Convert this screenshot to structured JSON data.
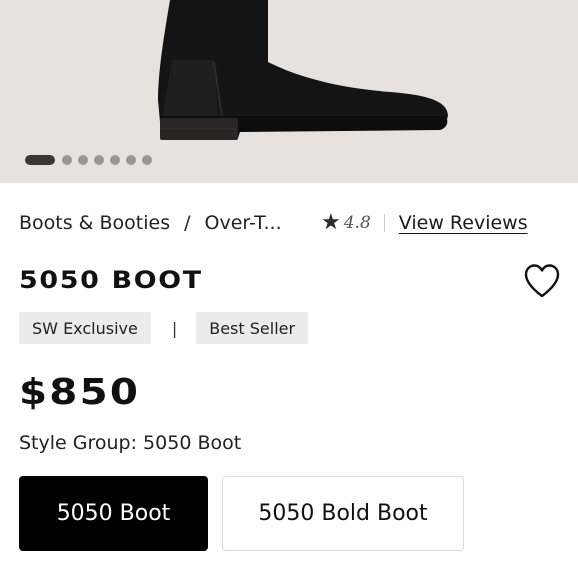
{
  "carousel": {
    "slide_count": 7,
    "active_index": 0,
    "background": "#e8e2df"
  },
  "breadcrumb": {
    "items": [
      "Boots & Booties",
      "Over-T..."
    ],
    "separator": "/"
  },
  "rating": {
    "star_icon": "star-icon",
    "value": "4.8",
    "reviews_label": "View Reviews"
  },
  "product": {
    "title": "5050 BOOT",
    "badges": [
      "SW Exclusive",
      "Best Seller"
    ],
    "badge_separator": "|",
    "price": "$850",
    "style_group_label": "Style Group: 5050 Boot"
  },
  "style_options": [
    {
      "label": "5050 Boot",
      "selected": true
    },
    {
      "label": "5050 Bold Boot",
      "selected": false
    }
  ],
  "colors": {
    "selected_bg": "#000000",
    "badge_bg": "#ebebeb",
    "text": "#1a1a1a"
  }
}
